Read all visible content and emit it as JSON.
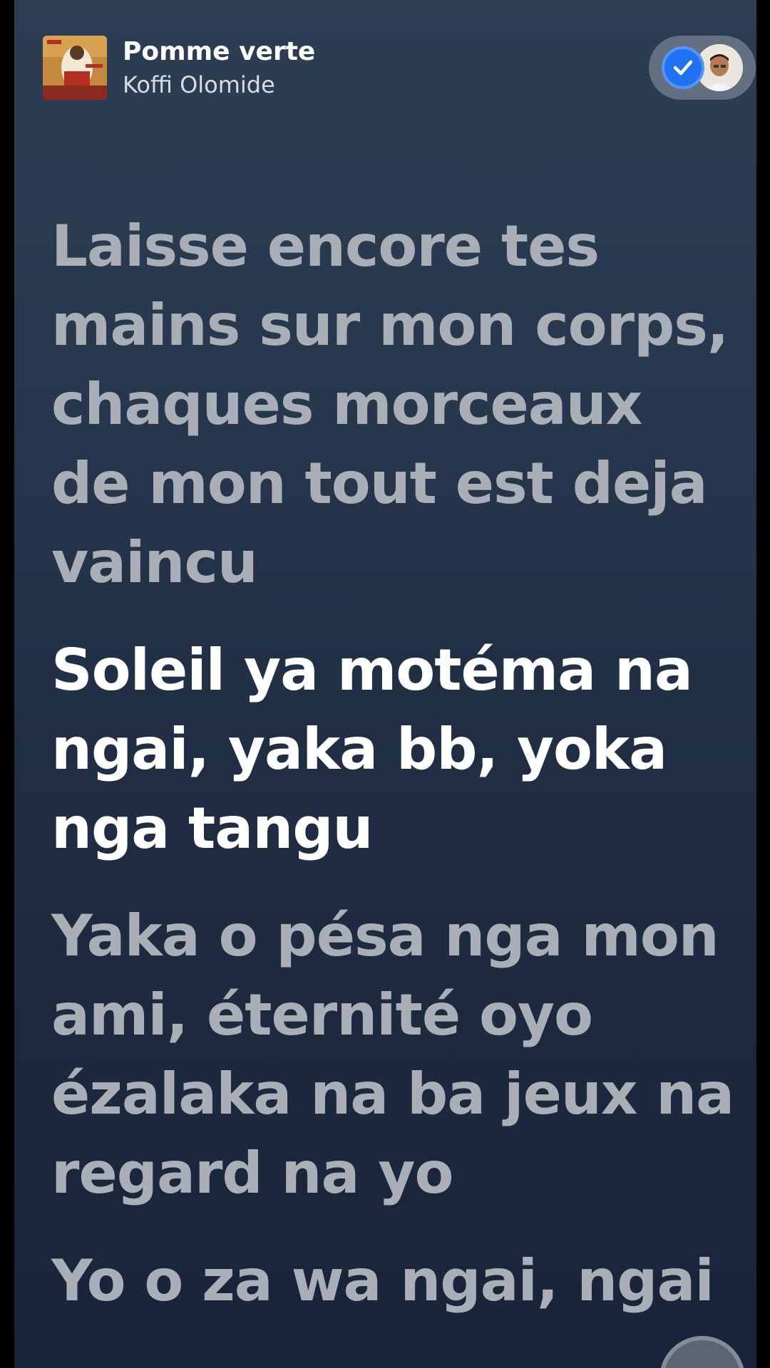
{
  "now_playing": {
    "title": "Pomme verte",
    "artist": "Koffi Olomide"
  },
  "session": {
    "status_icon": "check-icon",
    "avatar_icon": "user-avatar"
  },
  "lyrics": [
    {
      "text": "Laisse encore tes mains sur mon corps, chaques morceaux de mon tout est deja vaincu",
      "active": false
    },
    {
      "text": "Soleil ya motéma na ngai, yaka bb, yoka nga tangu",
      "active": true
    },
    {
      "text": "Yaka o pésa nga mon ami, éternité oyo ézalaka na ba jeux na regard na yo",
      "active": false
    },
    {
      "text": "Yo o za wa ngai, ngai",
      "active": false
    }
  ],
  "colors": {
    "accent": "#1f72f2",
    "active_lyric": "#ffffff",
    "inactive_lyric": "#a9aeb7",
    "background": "#27374d"
  }
}
